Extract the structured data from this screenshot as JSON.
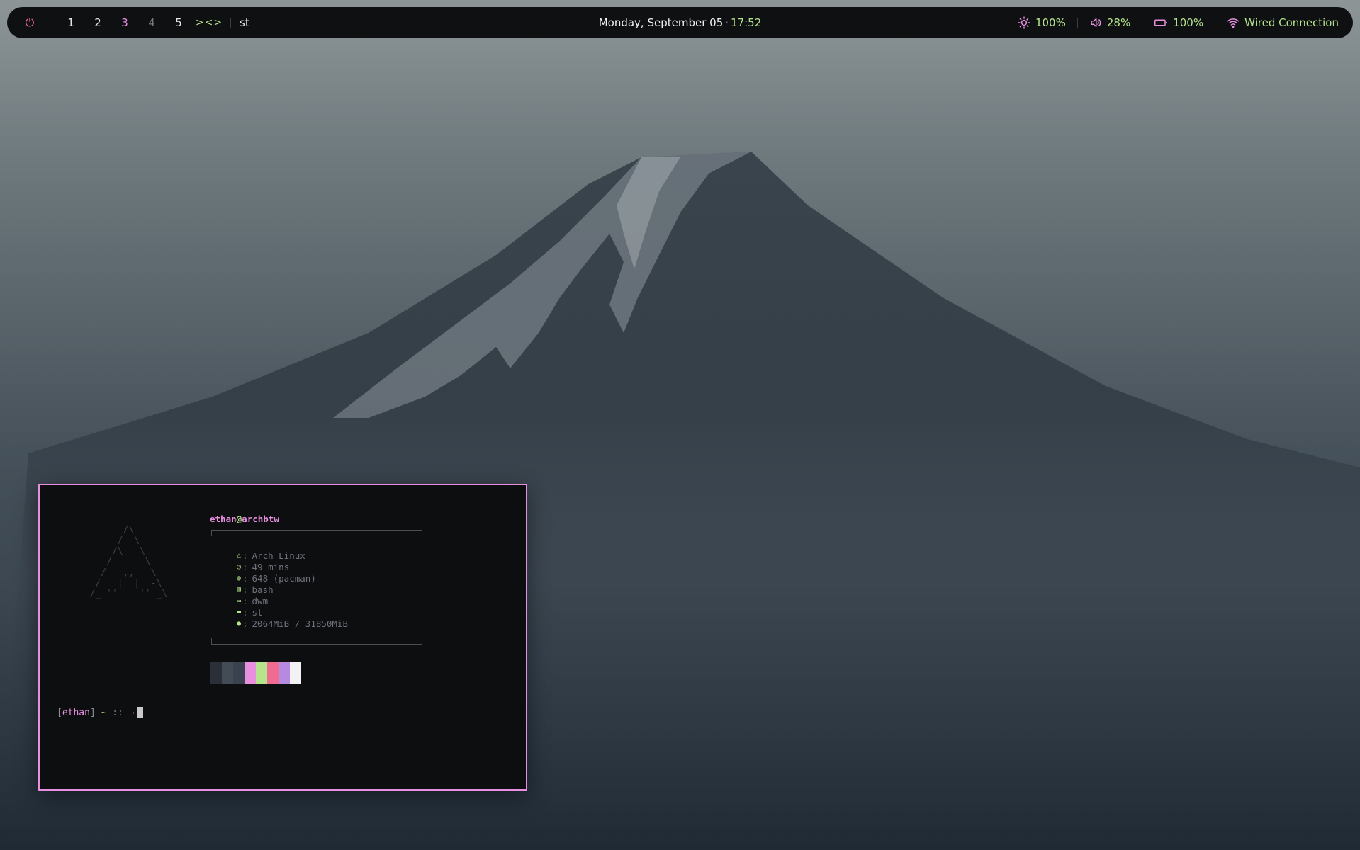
{
  "colors": {
    "accent_pink": "#e98fe0",
    "accent_green": "#b5e48c",
    "power_red": "#ef6b8f",
    "bar_bg": "#0e1012",
    "terminal_bg": "#0c0e10"
  },
  "topbar": {
    "power_icon": "power-icon",
    "workspaces": [
      "1",
      "2",
      "3",
      "4",
      "5"
    ],
    "active_workspace": "3",
    "layout_symbol": "><>",
    "window_title": "st",
    "date": "Monday, September 05",
    "time": "17:52",
    "brightness": {
      "icon": "sun-icon",
      "value": "100%"
    },
    "volume": {
      "icon": "speaker-icon",
      "value": "28%"
    },
    "battery": {
      "icon": "battery-icon",
      "value": "100%"
    },
    "network": {
      "icon": "wifi-icon",
      "value": "Wired Connection"
    }
  },
  "terminal": {
    "user": "ethan",
    "host": "archbtw",
    "info": [
      {
        "icon": "arch-icon",
        "value": "Arch Linux"
      },
      {
        "icon": "clock-icon",
        "value": "49 mins"
      },
      {
        "icon": "package-icon",
        "value": "648 (pacman)"
      },
      {
        "icon": "shell-icon",
        "value": "bash"
      },
      {
        "icon": "window-icon",
        "value": "dwm"
      },
      {
        "icon": "terminal-icon",
        "value": "st"
      },
      {
        "icon": "memory-icon",
        "value": "2064MiB / 31850MiB"
      }
    ],
    "palette": [
      "#2b3038",
      "#444b55",
      "#3a4250",
      "#e98fe0",
      "#b5e48c",
      "#ef6b8f",
      "#b58be0",
      "#f2f2f2"
    ],
    "prompt": {
      "user": "ethan",
      "tilde": "~",
      "sep": "::",
      "arrow": "→"
    }
  }
}
